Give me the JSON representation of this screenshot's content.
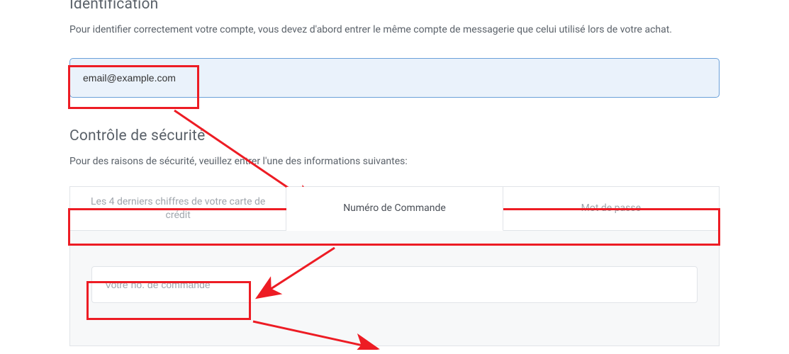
{
  "identification": {
    "title": "Identification",
    "desc": "Pour identifier correctement votre compte, vous devez d'abord entrer le même compte de messagerie que celui utilisé lors de votre achat.",
    "email_value": "email@example.com"
  },
  "security": {
    "title": "Contrôle de sécurité",
    "desc": "Pour des raisons de sécurité, veuillez entrer l'une des informations suivantes:",
    "tabs": [
      {
        "label": "Les 4 derniers chiffres de votre carte de crédit",
        "active": false
      },
      {
        "label": "Numéro de Commande",
        "active": true
      },
      {
        "label": "Mot de passe",
        "active": false
      }
    ],
    "order_placeholder": "Votre no. de commande"
  }
}
